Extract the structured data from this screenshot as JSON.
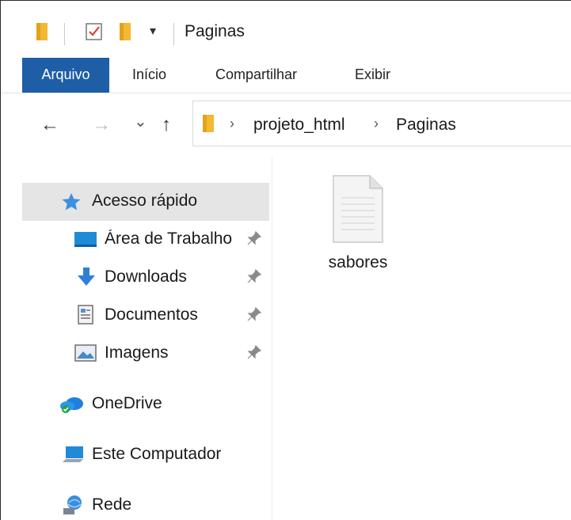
{
  "window": {
    "title": "Paginas",
    "quick_access_overflow": "▾"
  },
  "ribbon": {
    "tabs": [
      {
        "label": "Arquivo",
        "active": true
      },
      {
        "label": "Início"
      },
      {
        "label": "Compartilhar"
      },
      {
        "label": "Exibir"
      }
    ]
  },
  "nav": {
    "back_icon": "←",
    "forward_icon": "→",
    "recent_icon": "⌄",
    "up_icon": "↑",
    "breadcrumb": [
      "projeto_html",
      "Paginas"
    ],
    "separator": "›"
  },
  "sidebar": {
    "items": [
      {
        "label": "Acesso rápido",
        "icon": "star-icon",
        "selected": true
      },
      {
        "label": "Área de Trabalho",
        "icon": "desktop-icon",
        "pinned": true
      },
      {
        "label": "Downloads",
        "icon": "download-icon",
        "pinned": true
      },
      {
        "label": "Documentos",
        "icon": "document-icon",
        "pinned": true
      },
      {
        "label": "Imagens",
        "icon": "pictures-icon",
        "pinned": true
      },
      {
        "label": "OneDrive",
        "icon": "onedrive-icon"
      },
      {
        "label": "Este Computador",
        "icon": "computer-icon"
      },
      {
        "label": "Rede",
        "icon": "network-icon"
      }
    ]
  },
  "files": [
    {
      "name": "sabores",
      "icon": "generic-file-icon"
    }
  ],
  "colors": {
    "accent": "#1d5ea7",
    "selection": "#e5e5e5",
    "folder": "#f4c542"
  }
}
